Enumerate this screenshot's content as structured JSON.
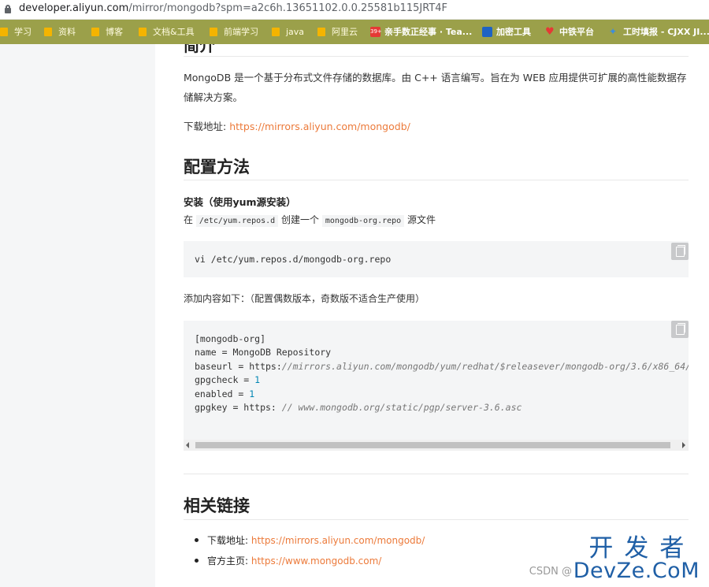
{
  "browser": {
    "url_host": "developer.aliyun.com",
    "url_rest": "/mirror/mongodb?spm=a2c6h.13651102.0.0.25581b115JRT4F",
    "bookmarks": [
      {
        "label": "学习",
        "type": "folder"
      },
      {
        "label": "资料",
        "type": "folder"
      },
      {
        "label": "博客",
        "type": "folder"
      },
      {
        "label": "文档&工具",
        "type": "folder"
      },
      {
        "label": "前端学习",
        "type": "folder"
      },
      {
        "label": "java",
        "type": "folder"
      },
      {
        "label": "阿里云",
        "type": "folder"
      },
      {
        "label": "亲手数正经事 · Tea...",
        "type": "site",
        "badge": "39+"
      },
      {
        "label": "加密工具",
        "type": "site"
      },
      {
        "label": "中铁平台",
        "type": "site"
      },
      {
        "label": "工时填报 - CJXX JI...",
        "type": "site"
      }
    ]
  },
  "article": {
    "intro_heading_fragment": "简介",
    "intro_text": "MongoDB 是一个基于分布式文件存储的数据库。由 C++ 语言编写。旨在为 WEB 应用提供可扩展的高性能数据存储解决方案。",
    "download_label": "下载地址: ",
    "download_url": "https://mirrors.aliyun.com/mongodb/",
    "config_heading": "配置方法",
    "install_heading": "安装（使用yum源安装）",
    "install_text_prefix": "在",
    "install_path": "/etc/yum.repos.d",
    "install_text_middle": "创建一个",
    "install_file": "mongodb-org.repo",
    "install_text_suffix": "源文件",
    "code1": "vi /etc/yum.repos.d/mongodb-org.repo",
    "add_content_text": "添加内容如下：（配置偶数版本，奇数版不适合生产使用）",
    "code2_lines": {
      "l1": "[mongodb-org]",
      "l2": "name = MongoDB Repository",
      "l3a": "baseurl = https:",
      "l3b": "//mirrors.aliyun.com/mongodb/yum/redhat/$releasever/mongodb-org/3.6/x86_64/",
      "l4a": "gpgcheck = ",
      "l4b": "1",
      "l5a": "enabled = ",
      "l5b": "1",
      "l6a": "gpgkey = https: ",
      "l6b": "// www.mongodb.org/static/pgp/server-3.6.asc"
    },
    "links_heading": "相关链接",
    "links": [
      {
        "label": "下载地址: ",
        "url": "https://mirrors.aliyun.com/mongodb/"
      },
      {
        "label": "官方主页: ",
        "url": "https://www.mongodb.com/"
      }
    ]
  },
  "watermark": {
    "cn": "开发者",
    "en": "DevZe.CoM",
    "csdn": "CSDN @"
  }
}
